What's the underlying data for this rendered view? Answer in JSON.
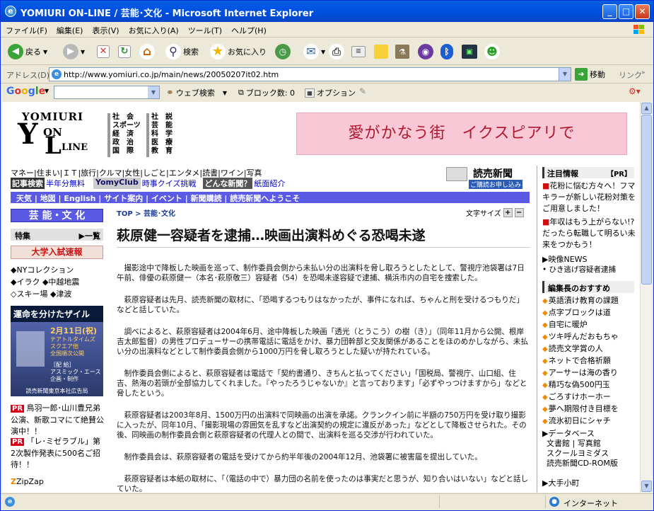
{
  "window": {
    "title": "YOMIURI ON-LINE / 芸能･文化 - Microsoft Internet Explorer",
    "min": "_",
    "max": "□",
    "close": "✕"
  },
  "menu": [
    "ファイル(F)",
    "編集(E)",
    "表示(V)",
    "お気に入り(A)",
    "ツール(T)",
    "ヘルプ(H)"
  ],
  "toolbar": {
    "back": "戻る",
    "search": "検索",
    "favorites": "お気に入り"
  },
  "address": {
    "label": "アドレス(D)",
    "url": "http://www.yomiuri.co.jp/main/news/20050207it02.htm",
    "go": "移動",
    "links": "リンク"
  },
  "google": {
    "logo": "Google",
    "web_search": "ウェブ検索",
    "blocked": "ブロック数: 0",
    "options": "オプション"
  },
  "header": {
    "logo": {
      "line1": "YOMIURI",
      "line2": "ON",
      "line3": "LINE"
    },
    "sections_left": [
      "社　会",
      "スポーツ",
      "経　済",
      "政　治",
      "国　際"
    ],
    "sections_right": [
      "社　説",
      "芸　能",
      "科　学",
      "医　療",
      "教　育"
    ],
    "banner": "愛がかなう街　イクスピアリで"
  },
  "nav": {
    "row1": [
      "マネー",
      "住まい",
      "ＩＴ",
      "旅行",
      "クルマ",
      "女性",
      "しごと",
      "エンタメ",
      "読書",
      "ワイン",
      "写真"
    ],
    "row2": {
      "kiji": "記事検索",
      "half": "半年分無料",
      "yomyclub": "YomyClub",
      "quiz": "時事クイズ挑戦",
      "donna": "どんな新聞？",
      "shimen": "紙面紹介"
    },
    "row3": [
      "天気",
      "地図",
      "English",
      "サイト案内",
      "イベント",
      "新聞購読",
      "読売新聞へようこそ"
    ],
    "subscribe_logo": "読売新聞",
    "subscribe_btn": "ご購読お申し込み"
  },
  "left": {
    "section": "芸 能・文 化",
    "tokushu": "特集",
    "ichiran": "▶一覧",
    "exam": "大学入試速報",
    "links": [
      "◆NYコレクション",
      "◆イラク ◆中越地震",
      "◇スキー場 ◆津波"
    ],
    "ad": {
      "title": "運命を分けたザイル",
      "date": "2月11日(祝)",
      "venue1": "テアトルタイムズ",
      "venue2": "スクエア他",
      "venue3": "全国順次公開",
      "dist_label": "［配 給］",
      "dist": "アスミック・エース",
      "prod_label": "企画・制作",
      "prod": "読売新聞東京本社広告局"
    },
    "pr1_badge": "PR",
    "pr1": "鳥羽一郎･山川豊兄弟公演、新歌コマにて絶賛公演中！！",
    "pr2_badge": "PR",
    "pr2": "「レ･ミゼラブル」第2次製作発表に500名ご招待！！",
    "zipzap": "ZipZap"
  },
  "main": {
    "breadcrumb_top": "TOP",
    "breadcrumb_sep": ">",
    "breadcrumb_section": "芸能･文化",
    "font_size": "文字サイズ",
    "headline": "萩原健一容疑者を逮捕…映画出演料めぐる恐喝未遂",
    "paragraphs": [
      "撮影途中で降板した映画を巡って、制作委員会側から未払い分の出演料を脅し取ろうとしたとして、警視庁池袋署は7日午前、俳優の萩原健一（本名･萩原敬三）容疑者（54）を恐喝未遂容疑で逮捕、横浜市内の自宅を捜索した。",
      "萩原容疑者は先月、読売新聞の取材に、「恐喝するつもりはなかったが、事件になれば、ちゃんと刑を受けるつもりだ」などと話していた。",
      "調べによると、萩原容疑者は2004年6月、途中降板した映画「透光（とうこう）の樹（き）」（同年11月から公開、根岸吉太郎監督）の男性プロデューサーの携帯電話に電話をかけ、暴力団幹部と交友関係があることをほのめかしながら、未払い分の出演料などとして制作委員会側から1000万円を脅し取ろうとした疑いが持たれている。",
      "制作委員会側によると、萩原容疑者は電話で「契約書通り、きちんと払ってください」「国税局、警視庁、山口組、住吉、熱海の若頭が全部協力してくれました。『やったろうじゃないか』と言っております」「必ずやっつけますから」などと脅したという。",
      "萩原容疑者は2003年8月、1500万円の出演料で同映画の出演を承諾。クランクイン前に半額の750万円を受け取り撮影に入ったが、同年10月、「撮影現場の雰囲気を乱すなど出演契約の規定に違反があった」などとして降板させられた。その後、同映画の制作委員会側と萩原容疑者の代理人との間で、出演料を巡る交渉が行われていた。",
      "制作委員会は、萩原容疑者の電話を受けてから約半年後の2004年12月、池袋署に被害届を提出していた。",
      "萩原容疑者は本紙の取材に、「（電話の中で）暴力団の名前を使ったのは事実だと思うが、知り合いはいない」などと話していた。"
    ]
  },
  "right": {
    "notice_title": "注目情報",
    "notice_pr": "【PR】",
    "notice1": "花粉に悩む方々へ！フマキラーが新しい花粉対策をご用意しました！",
    "notice2": "年収はもう上がらない!?だったら転職して明るい未来をつかもう！",
    "eizo_title": "映像NEWS",
    "eizo_item": "ひき逃げ容疑者逮捕",
    "recommend_title": "編集長のおすすめ",
    "recommend": [
      "英語漬け教育の課題",
      "点字ブロックは道",
      "自宅に暖炉",
      "ツキ呼んだおもちゃ",
      "読売文学賞の人",
      "ネットで合格祈願",
      "アーサーは海の香り",
      "精巧な偽500円玉",
      "ごろすけホーホー",
      "夢へ期限付き目標を",
      "流氷初日にシャチ"
    ],
    "db_title": "データベース",
    "db_items": [
      "文書館",
      "写真館",
      "スクールヨミダス",
      "読売新聞CD-ROM版"
    ],
    "db_sep": "|",
    "otemachi": "大手小町"
  },
  "status": {
    "zone": "インターネット"
  }
}
